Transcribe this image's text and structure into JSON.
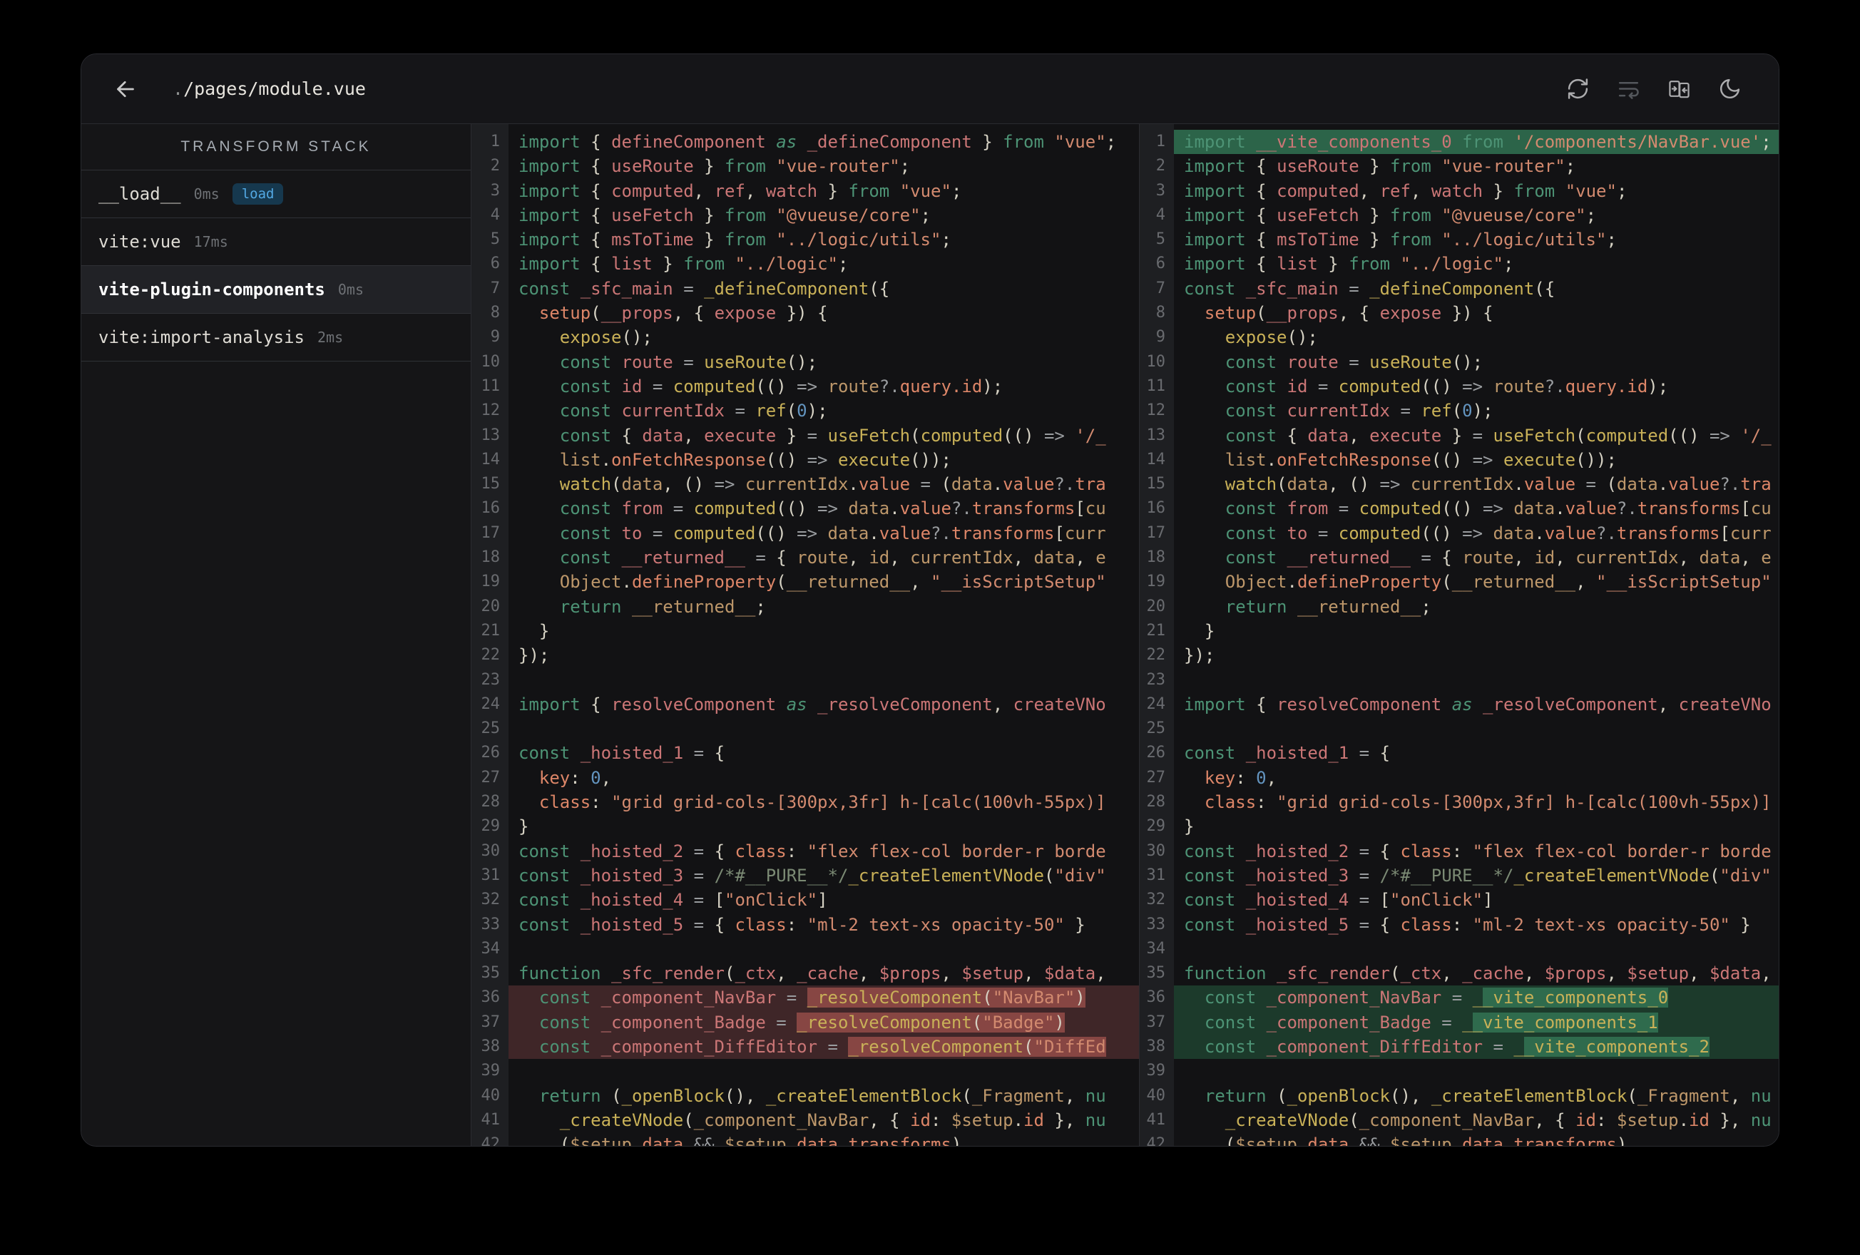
{
  "window": {
    "title_dot": ".",
    "title_path": "/pages/module.vue"
  },
  "header": {
    "icons": [
      {
        "name": "refresh-icon"
      },
      {
        "name": "wrap-lines-icon",
        "disabled": true
      },
      {
        "name": "split-diff-icon"
      },
      {
        "name": "dark-mode-icon"
      }
    ]
  },
  "sidebar": {
    "title": "TRANSFORM STACK",
    "items": [
      {
        "label": "__load__",
        "time": "0ms",
        "badge": "load",
        "selected": false
      },
      {
        "label": "vite:vue",
        "time": "17ms",
        "selected": false
      },
      {
        "label": "vite-plugin-components",
        "time": "0ms",
        "selected": true
      },
      {
        "label": "vite:import-analysis",
        "time": "2ms",
        "selected": false
      }
    ]
  },
  "colors": {
    "badge_text": "#53A9E4",
    "badge_bg": "#16384E",
    "diff_removed_line": "#3F2628",
    "diff_removed_inline": "#874643",
    "diff_added_line": "#1C3A2B",
    "diff_added_inline": "#2F6B4D",
    "diff_added_full_line": "#2C6449"
  },
  "code": {
    "left_marks": {
      "36": "rm",
      "37": "rm",
      "38": "rm"
    },
    "right_marks": {
      "1": "addfull",
      "36": "add",
      "37": "add",
      "38": "add"
    },
    "lines": [
      [
        [
          "k",
          "import"
        ],
        [
          "p",
          " { "
        ],
        [
          "d",
          "defineComponent"
        ],
        [
          "ki",
          " as "
        ],
        [
          "d",
          "_defineComponent"
        ],
        [
          "p",
          " } "
        ],
        [
          "k",
          "from "
        ],
        [
          "s",
          "\"vue\""
        ],
        [
          "p",
          ";"
        ]
      ],
      [
        [
          "k",
          "import"
        ],
        [
          "p",
          " { "
        ],
        [
          "d",
          "useRoute"
        ],
        [
          "p",
          " } "
        ],
        [
          "k",
          "from "
        ],
        [
          "s",
          "\"vue-router\""
        ],
        [
          "p",
          ";"
        ]
      ],
      [
        [
          "k",
          "import"
        ],
        [
          "p",
          " { "
        ],
        [
          "d",
          "computed"
        ],
        [
          "p",
          ", "
        ],
        [
          "d",
          "ref"
        ],
        [
          "p",
          ", "
        ],
        [
          "d",
          "watch"
        ],
        [
          "p",
          " } "
        ],
        [
          "k",
          "from "
        ],
        [
          "s",
          "\"vue\""
        ],
        [
          "p",
          ";"
        ]
      ],
      [
        [
          "k",
          "import"
        ],
        [
          "p",
          " { "
        ],
        [
          "d",
          "useFetch"
        ],
        [
          "p",
          " } "
        ],
        [
          "k",
          "from "
        ],
        [
          "s",
          "\"@vueuse/core\""
        ],
        [
          "p",
          ";"
        ]
      ],
      [
        [
          "k",
          "import"
        ],
        [
          "p",
          " { "
        ],
        [
          "d",
          "msToTime"
        ],
        [
          "p",
          " } "
        ],
        [
          "k",
          "from "
        ],
        [
          "s",
          "\"../logic/utils\""
        ],
        [
          "p",
          ";"
        ]
      ],
      [
        [
          "k",
          "import"
        ],
        [
          "p",
          " { "
        ],
        [
          "d",
          "list"
        ],
        [
          "p",
          " } "
        ],
        [
          "k",
          "from "
        ],
        [
          "s",
          "\"../logic\""
        ],
        [
          "p",
          ";"
        ]
      ],
      [
        [
          "k",
          "const "
        ],
        [
          "d",
          "_sfc_main"
        ],
        [
          "o",
          " = "
        ],
        [
          "fn",
          "_defineComponent"
        ],
        [
          "p",
          "({"
        ]
      ],
      [
        [
          "p",
          "  "
        ],
        [
          "pr",
          "setup"
        ],
        [
          "p",
          "("
        ],
        [
          "d",
          "__props"
        ],
        [
          "p",
          ", { "
        ],
        [
          "d",
          "expose"
        ],
        [
          "p",
          " }) {"
        ]
      ],
      [
        [
          "p",
          "    "
        ],
        [
          "fn",
          "expose"
        ],
        [
          "p",
          "();"
        ]
      ],
      [
        [
          "p",
          "    "
        ],
        [
          "k",
          "const "
        ],
        [
          "d",
          "route"
        ],
        [
          "o",
          " = "
        ],
        [
          "fn",
          "useRoute"
        ],
        [
          "p",
          "();"
        ]
      ],
      [
        [
          "p",
          "    "
        ],
        [
          "k",
          "const "
        ],
        [
          "d",
          "id"
        ],
        [
          "o",
          " = "
        ],
        [
          "fn",
          "computed"
        ],
        [
          "p",
          "(() "
        ],
        [
          "o",
          "=> "
        ],
        [
          "u",
          "route"
        ],
        [
          "o",
          "?."
        ],
        [
          "pr",
          "query.id"
        ],
        [
          "p",
          ");"
        ]
      ],
      [
        [
          "p",
          "    "
        ],
        [
          "k",
          "const "
        ],
        [
          "d",
          "currentIdx"
        ],
        [
          "o",
          " = "
        ],
        [
          "fn",
          "ref"
        ],
        [
          "p",
          "("
        ],
        [
          "n",
          "0"
        ],
        [
          "p",
          ");"
        ]
      ],
      [
        [
          "p",
          "    "
        ],
        [
          "k",
          "const "
        ],
        [
          "p",
          "{ "
        ],
        [
          "d",
          "data"
        ],
        [
          "p",
          ", "
        ],
        [
          "d",
          "execute"
        ],
        [
          "p",
          " } "
        ],
        [
          "o",
          "= "
        ],
        [
          "fn",
          "useFetch"
        ],
        [
          "p",
          "("
        ],
        [
          "fn",
          "computed"
        ],
        [
          "p",
          "(() "
        ],
        [
          "o",
          "=> "
        ],
        [
          "s",
          "'/_"
        ]
      ],
      [
        [
          "p",
          "    "
        ],
        [
          "u",
          "list"
        ],
        [
          "p",
          "."
        ],
        [
          "pr",
          "onFetchResponse"
        ],
        [
          "p",
          "(() "
        ],
        [
          "o",
          "=> "
        ],
        [
          "fn",
          "execute"
        ],
        [
          "p",
          "());"
        ]
      ],
      [
        [
          "p",
          "    "
        ],
        [
          "fn",
          "watch"
        ],
        [
          "p",
          "("
        ],
        [
          "u",
          "data"
        ],
        [
          "p",
          ", () "
        ],
        [
          "o",
          "=> "
        ],
        [
          "u",
          "currentIdx"
        ],
        [
          "p",
          "."
        ],
        [
          "pr",
          "value"
        ],
        [
          "o",
          " = "
        ],
        [
          "p",
          "("
        ],
        [
          "u",
          "data"
        ],
        [
          "p",
          "."
        ],
        [
          "pr",
          "value"
        ],
        [
          "o",
          "?."
        ],
        [
          "pr",
          "tra"
        ]
      ],
      [
        [
          "p",
          "    "
        ],
        [
          "k",
          "const "
        ],
        [
          "d",
          "from"
        ],
        [
          "o",
          " = "
        ],
        [
          "fn",
          "computed"
        ],
        [
          "p",
          "(() "
        ],
        [
          "o",
          "=> "
        ],
        [
          "u",
          "data"
        ],
        [
          "p",
          "."
        ],
        [
          "pr",
          "value"
        ],
        [
          "o",
          "?."
        ],
        [
          "pr",
          "transforms"
        ],
        [
          "p",
          "["
        ],
        [
          "u",
          "cu"
        ]
      ],
      [
        [
          "p",
          "    "
        ],
        [
          "k",
          "const "
        ],
        [
          "d",
          "to"
        ],
        [
          "o",
          " = "
        ],
        [
          "fn",
          "computed"
        ],
        [
          "p",
          "(() "
        ],
        [
          "o",
          "=> "
        ],
        [
          "u",
          "data"
        ],
        [
          "p",
          "."
        ],
        [
          "pr",
          "value"
        ],
        [
          "o",
          "?."
        ],
        [
          "pr",
          "transforms"
        ],
        [
          "p",
          "["
        ],
        [
          "u",
          "curr"
        ]
      ],
      [
        [
          "p",
          "    "
        ],
        [
          "k",
          "const "
        ],
        [
          "d",
          "__returned__"
        ],
        [
          "o",
          " = "
        ],
        [
          "p",
          "{ "
        ],
        [
          "u",
          "route"
        ],
        [
          "p",
          ", "
        ],
        [
          "u",
          "id"
        ],
        [
          "p",
          ", "
        ],
        [
          "u",
          "currentIdx"
        ],
        [
          "p",
          ", "
        ],
        [
          "u",
          "data"
        ],
        [
          "p",
          ", "
        ],
        [
          "u",
          "e"
        ]
      ],
      [
        [
          "p",
          "    "
        ],
        [
          "u",
          "Object"
        ],
        [
          "p",
          "."
        ],
        [
          "pr",
          "defineProperty"
        ],
        [
          "p",
          "("
        ],
        [
          "u",
          "__returned__"
        ],
        [
          "p",
          ", "
        ],
        [
          "s",
          "\"__isScriptSetup\""
        ]
      ],
      [
        [
          "p",
          "    "
        ],
        [
          "k",
          "return "
        ],
        [
          "u",
          "__returned__"
        ],
        [
          "p",
          ";"
        ]
      ],
      [
        [
          "p",
          "  }"
        ]
      ],
      [
        [
          "p",
          "});"
        ]
      ],
      [],
      [
        [
          "k",
          "import"
        ],
        [
          "p",
          " { "
        ],
        [
          "d",
          "resolveComponent"
        ],
        [
          "ki",
          " as "
        ],
        [
          "d",
          "_resolveComponent"
        ],
        [
          "p",
          ", "
        ],
        [
          "d",
          "createVNo"
        ]
      ],
      [],
      [
        [
          "k",
          "const "
        ],
        [
          "d",
          "_hoisted_1"
        ],
        [
          "o",
          " = "
        ],
        [
          "p",
          "{"
        ]
      ],
      [
        [
          "p",
          "  "
        ],
        [
          "pr",
          "key"
        ],
        [
          "p",
          ": "
        ],
        [
          "n",
          "0"
        ],
        [
          "p",
          ","
        ]
      ],
      [
        [
          "p",
          "  "
        ],
        [
          "pr",
          "class"
        ],
        [
          "p",
          ": "
        ],
        [
          "s",
          "\"grid grid-cols-[300px,3fr] h-[calc(100vh-55px)]"
        ]
      ],
      [
        [
          "p",
          "}"
        ]
      ],
      [
        [
          "k",
          "const "
        ],
        [
          "d",
          "_hoisted_2"
        ],
        [
          "o",
          " = "
        ],
        [
          "p",
          "{ "
        ],
        [
          "pr",
          "class"
        ],
        [
          "p",
          ": "
        ],
        [
          "s",
          "\"flex flex-col border-r borde"
        ]
      ],
      [
        [
          "k",
          "const "
        ],
        [
          "d",
          "_hoisted_3"
        ],
        [
          "o",
          " = "
        ],
        [
          "cm",
          "/*#__PURE__*/"
        ],
        [
          "fn",
          "_createElementVNode"
        ],
        [
          "p",
          "("
        ],
        [
          "s",
          "\"div\""
        ]
      ],
      [
        [
          "k",
          "const "
        ],
        [
          "d",
          "_hoisted_4"
        ],
        [
          "o",
          " = "
        ],
        [
          "p",
          "["
        ],
        [
          "s",
          "\"onClick\""
        ],
        [
          "p",
          "]"
        ]
      ],
      [
        [
          "k",
          "const "
        ],
        [
          "d",
          "_hoisted_5"
        ],
        [
          "o",
          " = "
        ],
        [
          "p",
          "{ "
        ],
        [
          "pr",
          "class"
        ],
        [
          "p",
          ": "
        ],
        [
          "s",
          "\"ml-2 text-xs opacity-50\""
        ],
        [
          "p",
          " }"
        ]
      ],
      [],
      [
        [
          "k",
          "function "
        ],
        [
          "d",
          "_sfc_render"
        ],
        [
          "p",
          "("
        ],
        [
          "d",
          "_ctx"
        ],
        [
          "p",
          ", "
        ],
        [
          "d",
          "_cache"
        ],
        [
          "p",
          ", "
        ],
        [
          "d",
          "$props"
        ],
        [
          "p",
          ", "
        ],
        [
          "d",
          "$setup"
        ],
        [
          "p",
          ", "
        ],
        [
          "d",
          "$data"
        ],
        [
          "p",
          ","
        ]
      ],
      [
        [
          "p",
          "  "
        ],
        [
          "k",
          "const "
        ],
        [
          "d",
          "_component_NavBar"
        ],
        [
          "o",
          " = "
        ],
        [
          "fn",
          "_resolveComponent",
          1
        ],
        [
          "p",
          "(",
          1
        ],
        [
          "s",
          "\"NavBar\"",
          1
        ],
        [
          "p",
          ")",
          1
        ]
      ],
      [
        [
          "p",
          "  "
        ],
        [
          "k",
          "const "
        ],
        [
          "d",
          "_component_Badge"
        ],
        [
          "o",
          " = "
        ],
        [
          "fn",
          "_resolveComponent",
          1
        ],
        [
          "p",
          "(",
          1
        ],
        [
          "s",
          "\"Badge\"",
          1
        ],
        [
          "p",
          ")",
          1
        ]
      ],
      [
        [
          "p",
          "  "
        ],
        [
          "k",
          "const "
        ],
        [
          "d",
          "_component_DiffEditor"
        ],
        [
          "o",
          " = "
        ],
        [
          "fn",
          "_resolveComponent",
          1
        ],
        [
          "p",
          "(",
          1
        ],
        [
          "s",
          "\"DiffEd",
          1
        ]
      ],
      [],
      [
        [
          "p",
          "  "
        ],
        [
          "k",
          "return "
        ],
        [
          "p",
          "("
        ],
        [
          "fn",
          "_openBlock"
        ],
        [
          "p",
          "(), "
        ],
        [
          "fn",
          "_createElementBlock"
        ],
        [
          "p",
          "("
        ],
        [
          "u",
          "_Fragment"
        ],
        [
          "p",
          ", "
        ],
        [
          "k",
          "nu"
        ]
      ],
      [
        [
          "p",
          "    "
        ],
        [
          "fn",
          "_createVNode"
        ],
        [
          "p",
          "("
        ],
        [
          "u",
          "_component_NavBar"
        ],
        [
          "p",
          ", { "
        ],
        [
          "pr",
          "id"
        ],
        [
          "p",
          ": "
        ],
        [
          "u",
          "$setup"
        ],
        [
          "p",
          "."
        ],
        [
          "pr",
          "id"
        ],
        [
          "p",
          " }, "
        ],
        [
          "k",
          "nu"
        ]
      ],
      [
        [
          "p",
          "    ("
        ],
        [
          "u",
          "$setup"
        ],
        [
          "p",
          "."
        ],
        [
          "pr",
          "data"
        ],
        [
          "o",
          " && "
        ],
        [
          "u",
          "$setup"
        ],
        [
          "p",
          "."
        ],
        [
          "pr",
          "data"
        ],
        [
          "p",
          "."
        ],
        [
          "pr",
          "transforms"
        ],
        [
          "p",
          ")"
        ]
      ]
    ],
    "right_overrides": {
      "1": [
        [
          "k",
          "import "
        ],
        [
          "d",
          "__vite_components_0"
        ],
        [
          "k",
          " from "
        ],
        [
          "s",
          "'/components/NavBar.vue'"
        ],
        [
          "p",
          ";"
        ]
      ],
      "36": [
        [
          "p",
          "  "
        ],
        [
          "k",
          "const "
        ],
        [
          "d",
          "_component_NavBar"
        ],
        [
          "o",
          " = "
        ],
        [
          "fn",
          "_"
        ],
        [
          "fn",
          "_vite_components_0",
          1
        ]
      ],
      "37": [
        [
          "p",
          "  "
        ],
        [
          "k",
          "const "
        ],
        [
          "d",
          "_component_Badge"
        ],
        [
          "o",
          " = "
        ],
        [
          "fn",
          "_"
        ],
        [
          "fn",
          "_vite_components_1",
          1
        ]
      ],
      "38": [
        [
          "p",
          "  "
        ],
        [
          "k",
          "const "
        ],
        [
          "d",
          "_component_DiffEditor"
        ],
        [
          "o",
          " = "
        ],
        [
          "fn",
          "_"
        ],
        [
          "fn",
          "_vite_components_2",
          1
        ]
      ]
    }
  }
}
